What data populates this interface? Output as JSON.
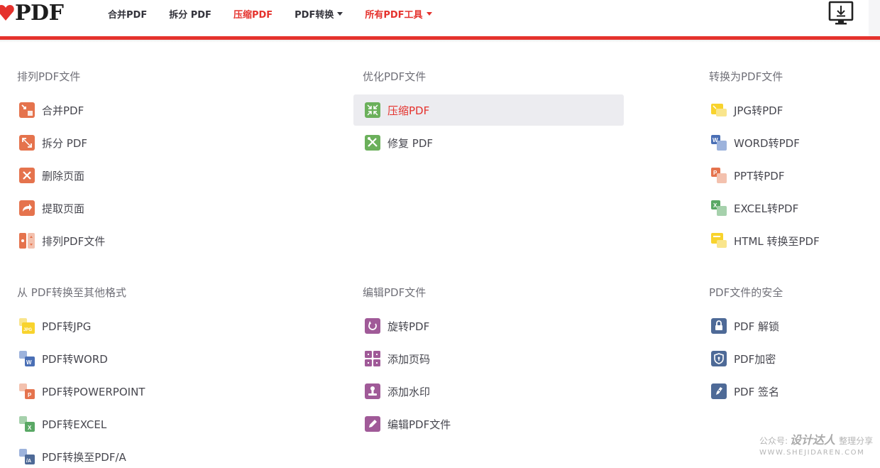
{
  "header": {
    "logo_text": "PDF",
    "nav": [
      {
        "label": "合并PDF",
        "active": false,
        "dropdown": false
      },
      {
        "label": "拆分 PDF",
        "active": false,
        "dropdown": false
      },
      {
        "label": "压缩PDF",
        "active": true,
        "dropdown": false
      },
      {
        "label": "PDF转换",
        "active": false,
        "dropdown": true
      },
      {
        "label": "所有PDF工具",
        "active": true,
        "dropdown": true
      }
    ],
    "desktop_icon": "monitor-download-icon"
  },
  "colors": {
    "brand_red": "#e5322d",
    "orange": "#e5734d",
    "green": "#6bb05b",
    "yellow": "#f8d32d",
    "blue": "#4a6fb5",
    "purple": "#a05a98",
    "steel": "#4e6a97"
  },
  "sections": [
    {
      "title": "排列PDF文件",
      "tools": [
        {
          "label": "合并PDF",
          "icon": "merge-icon"
        },
        {
          "label": "拆分 PDF",
          "icon": "split-icon"
        },
        {
          "label": "删除页面",
          "icon": "delete-pages-icon"
        },
        {
          "label": "提取页面",
          "icon": "extract-pages-icon"
        },
        {
          "label": "排列PDF文件",
          "icon": "organize-icon"
        }
      ]
    },
    {
      "title": "优化PDF文件",
      "tools": [
        {
          "label": "压缩PDF",
          "icon": "compress-icon",
          "active": true
        },
        {
          "label": "修复 PDF",
          "icon": "repair-icon"
        }
      ]
    },
    {
      "title": "转换为PDF文件",
      "tools": [
        {
          "label": "JPG转PDF",
          "icon": "jpg-to-pdf-icon"
        },
        {
          "label": "WORD转PDF",
          "icon": "word-to-pdf-icon"
        },
        {
          "label": "PPT转PDF",
          "icon": "ppt-to-pdf-icon"
        },
        {
          "label": "EXCEL转PDF",
          "icon": "excel-to-pdf-icon"
        },
        {
          "label": "HTML 转换至PDF",
          "icon": "html-to-pdf-icon"
        }
      ]
    },
    {
      "title": "从 PDF转换至其他格式",
      "tools": [
        {
          "label": "PDF转JPG",
          "icon": "pdf-to-jpg-icon"
        },
        {
          "label": "PDF转WORD",
          "icon": "pdf-to-word-icon"
        },
        {
          "label": "PDF转POWERPOINT",
          "icon": "pdf-to-powerpoint-icon"
        },
        {
          "label": "PDF转EXCEL",
          "icon": "pdf-to-excel-icon"
        },
        {
          "label": "PDF转换至PDF/A",
          "icon": "pdf-to-pdfa-icon"
        }
      ]
    },
    {
      "title": "编辑PDF文件",
      "tools": [
        {
          "label": "旋转PDF",
          "icon": "rotate-icon"
        },
        {
          "label": "添加页码",
          "icon": "page-numbers-icon"
        },
        {
          "label": "添加水印",
          "icon": "watermark-icon"
        },
        {
          "label": "编辑PDF文件",
          "icon": "edit-pdf-icon"
        }
      ]
    },
    {
      "title": "PDF文件的安全",
      "tools": [
        {
          "label": "PDF 解锁",
          "icon": "unlock-icon"
        },
        {
          "label": "PDF加密",
          "icon": "protect-icon"
        },
        {
          "label": "PDF 签名",
          "icon": "sign-icon"
        }
      ]
    }
  ],
  "watermark": {
    "prefix": "公众号:",
    "brand": "设计达人",
    "suffix": "整理分享",
    "url": "WWW.SHEJIDAREN.COM"
  }
}
